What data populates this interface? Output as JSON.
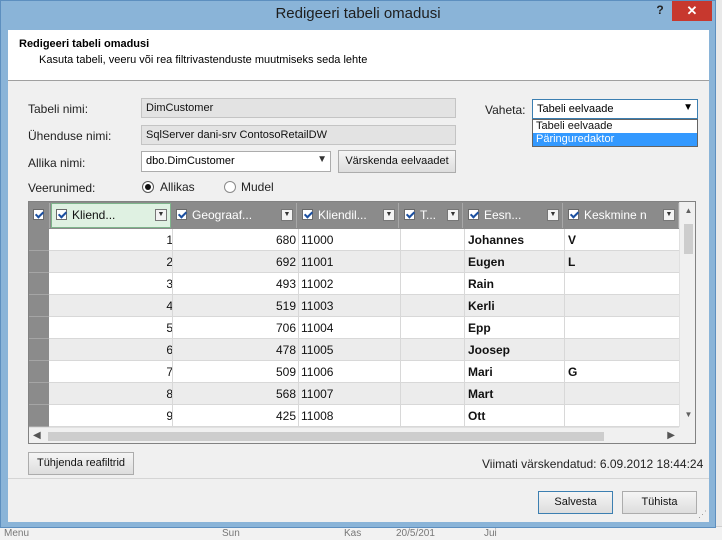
{
  "dialog": {
    "title": "Redigeeri tabeli omadusi",
    "help_label": "?",
    "close_label": "✕"
  },
  "header": {
    "title": "Redigeeri tabeli omadusi",
    "subtitle": "Kasuta tabeli, veeru või rea filtrivastenduste muutmiseks seda lehte"
  },
  "form": {
    "table_name_label": "Tabeli nimi:",
    "table_name_value": "DimCustomer",
    "connection_label": "Ühenduse nimi:",
    "connection_value": "SqlServer dani-srv ContosoRetailDW",
    "source_label": "Allika nimi:",
    "source_value": "dbo.DimCustomer",
    "refresh_button": "Värskenda eelvaadet",
    "column_names_label": "Veerunimed:",
    "radio_source": "Allikas",
    "radio_model": "Mudel",
    "switch_label": "Vaheta:",
    "switch_value": "Tabeli eelvaade",
    "switch_options": [
      "Tabeli eelvaade",
      "Päringuredaktor"
    ]
  },
  "grid": {
    "columns": [
      "Kliend...",
      "Geograaf...",
      "Kliendil...",
      "T...",
      "Eesn...",
      "Keskmine n"
    ],
    "rows": [
      [
        "1",
        "680",
        "11000",
        "",
        "Johannes",
        "V"
      ],
      [
        "2",
        "692",
        "11001",
        "",
        "Eugen",
        "L"
      ],
      [
        "3",
        "493",
        "11002",
        "",
        "Rain",
        ""
      ],
      [
        "4",
        "519",
        "11003",
        "",
        "Kerli",
        ""
      ],
      [
        "5",
        "706",
        "11004",
        "",
        "Epp",
        ""
      ],
      [
        "6",
        "478",
        "11005",
        "",
        "Joosep",
        ""
      ],
      [
        "7",
        "509",
        "11006",
        "",
        "Mari",
        "G"
      ],
      [
        "8",
        "568",
        "11007",
        "",
        "Mart",
        ""
      ],
      [
        "9",
        "425",
        "11008",
        "",
        "Ott",
        ""
      ]
    ]
  },
  "footer": {
    "clear_filters_button": "Tühjenda reafiltrid",
    "last_refreshed": "Viimati värskendatud: 6.09.2012 18:44:24",
    "save_button": "Salvesta",
    "cancel_button": "Tühista"
  },
  "background": {
    "fragments": [
      "Menu",
      "Sun",
      "Kas",
      "20/5/201",
      "Jui"
    ]
  }
}
